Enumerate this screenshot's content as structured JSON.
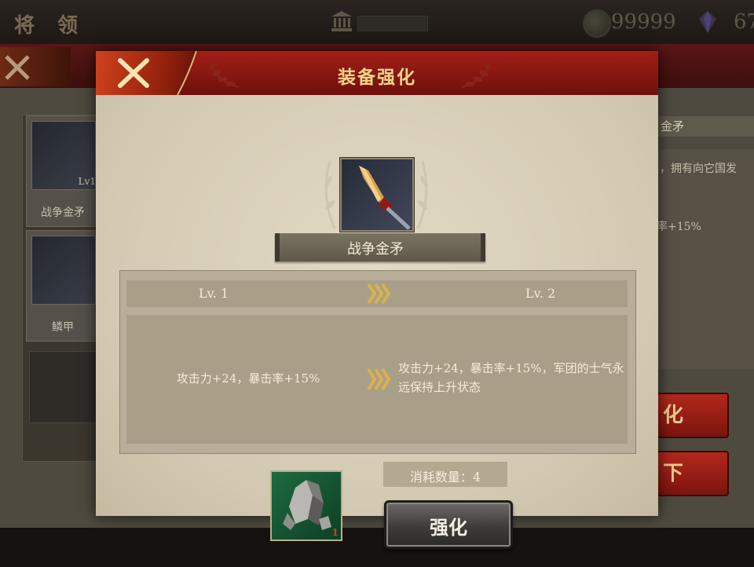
{
  "topbar": {
    "title": "将 领",
    "coins": "99999",
    "gems": "67"
  },
  "background": {
    "list": [
      {
        "label": "战争金矛",
        "level": "Lv1"
      },
      {
        "label": "鳞甲"
      }
    ],
    "detail_title": "金矛",
    "detail_desc": "，拥有向它国发",
    "detail_stat": "率+15%",
    "btn_upgrade": "化",
    "btn_unequip": "下"
  },
  "dialog": {
    "title": "装备强化",
    "item_name": "战争金矛",
    "level_current": "Lv. 1",
    "level_next": "Lv. 2",
    "stats_current": "攻击力+24，暴击率+15%",
    "stats_next": "攻击力+24，暴击率+15%，军团的士气永远保持上升状态",
    "material_count": "1",
    "cost_label": "消耗数量：4",
    "enhance_label": "强化"
  },
  "colors": {
    "header_red": "#8e1a12",
    "title_gold": "#f2d48c",
    "panel_parchment": "#dcd3bf",
    "material_green": "#1d6b40",
    "button_red": "#a02218"
  }
}
